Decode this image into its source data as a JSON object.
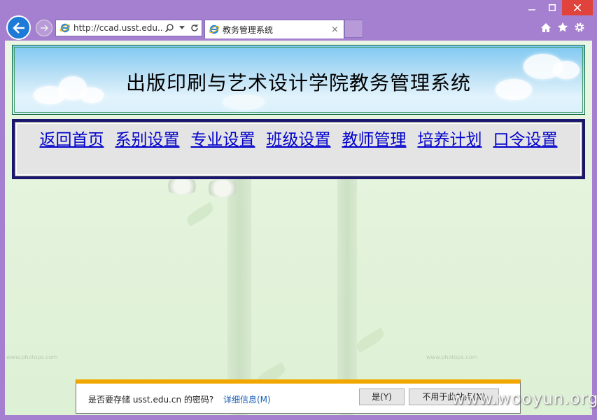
{
  "browser": {
    "url": "http://ccad.usst.edu....",
    "tab_title": "教务管理系统",
    "tab_close": "×",
    "colors": {
      "chrome": "#a57fd0",
      "close": "#e0433b",
      "back": "#1d7ad6"
    }
  },
  "page": {
    "title": "出版印刷与艺术设计学院教务管理系统",
    "nav": [
      {
        "label": "返回首页"
      },
      {
        "label": "系别设置"
      },
      {
        "label": "专业设置"
      },
      {
        "label": "班级设置"
      },
      {
        "label": "教师管理"
      },
      {
        "label": "培养计划"
      },
      {
        "label": "口令设置"
      }
    ],
    "watermark": "www.photops.com",
    "colors": {
      "link": "#0000cc",
      "nav_border": "#1a166e"
    }
  },
  "password_bar": {
    "question": "是否要存储 usst.edu.cn 的密码?",
    "more_link": "详细信息(M)",
    "yes_label": "是(Y)",
    "never_label": "不用于此站点(N)",
    "accent": "#f2a700"
  },
  "brand": "www.wooyun.org"
}
